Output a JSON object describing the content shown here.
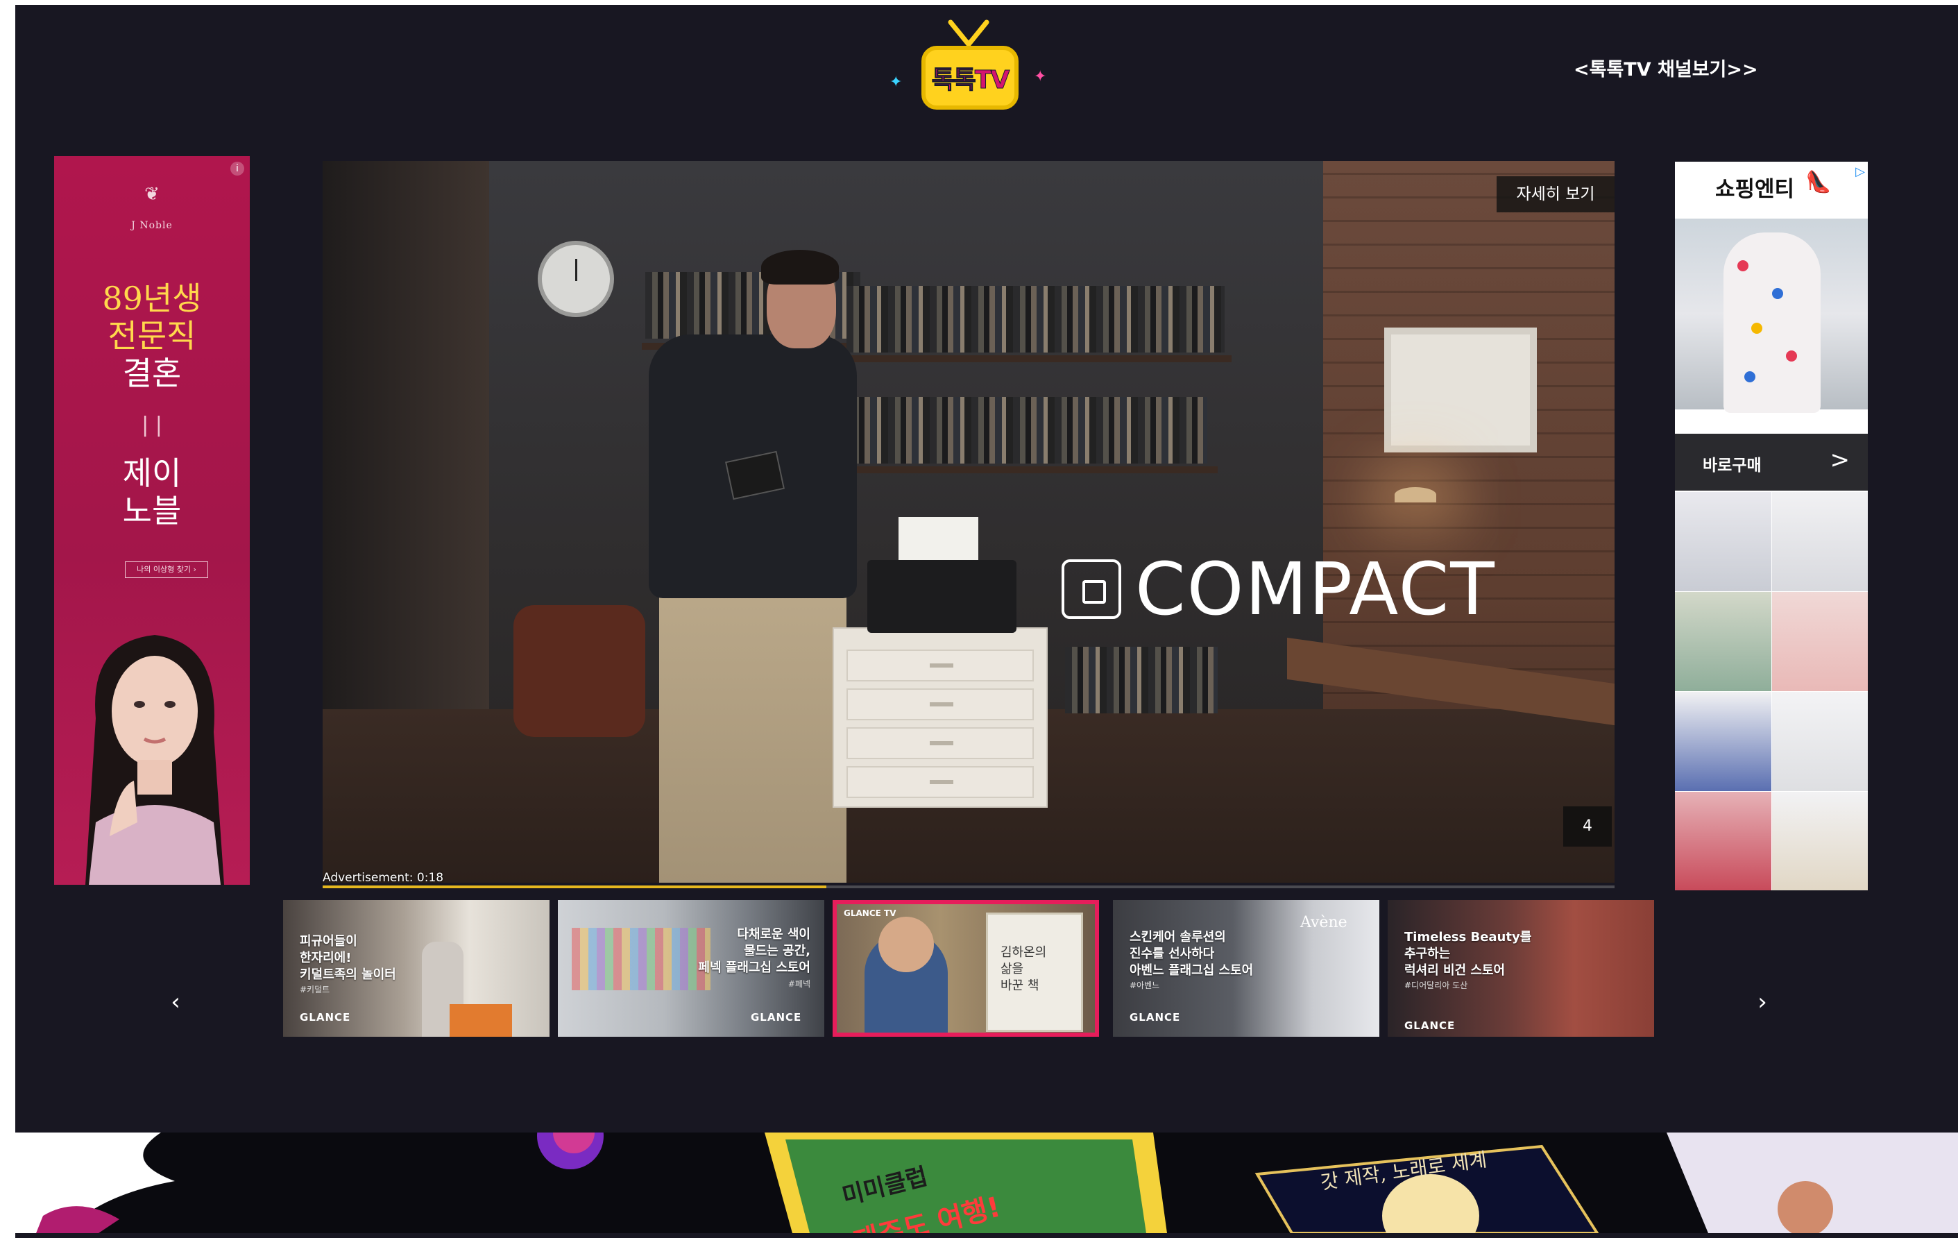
{
  "header": {
    "logo_text": "톡톡TV",
    "channel_link": "<톡톡TV 채널보기>>"
  },
  "left_ad": {
    "brand": "J Noble",
    "headline_1": "89년생",
    "headline_2": "전문직",
    "headline_3": "결혼",
    "divider": "| |",
    "sub_1": "제이",
    "sub_2": "노블",
    "cta": "나의 이상형 찾기  ›",
    "info": "i"
  },
  "video": {
    "overlay_word": "COMPACT",
    "more_button": "자세히 보기",
    "skip_count": "4",
    "ad_label": "Advertisement: 0:18",
    "progress_fraction": 0.39
  },
  "right_ad": {
    "brand": "쇼핑엔티",
    "buy_label": "바로구매",
    "buy_arrow": ">"
  },
  "carousel": {
    "prev": "‹",
    "next": "›",
    "items": [
      {
        "title_1": "피규어들이",
        "title_2": "한자리에!",
        "title_3": "키덜트족의 놀이터",
        "tag": "#키덜트",
        "brand": "GLANCE"
      },
      {
        "title_1": "다채로운 색이",
        "title_2": "물드는 공간,",
        "title_3": "페넥 플래그십 스토어",
        "tag": "#페넥",
        "brand": "GLANCE"
      },
      {
        "title_1": "김하온의",
        "title_2": "삶을",
        "title_3": "바꾼 책",
        "tag": "GLANCE TV",
        "brand": ""
      },
      {
        "title_1": "스킨케어 솔루션의",
        "title_2": "진수를 선사하다",
        "title_3": "아벤느 플래그십 스토어",
        "tag": "#아벤느",
        "brand": "GLANCE",
        "sign": "Avène"
      },
      {
        "title_1": "Timeless Beauty를",
        "title_2": "추구하는",
        "title_3": "럭셔리 비건 스토어",
        "tag": "#디어달리아 도산",
        "brand": "GLANCE"
      }
    ]
  },
  "bottom_banner": {
    "sign_text": "미미클럽",
    "sign_text_2": "제주도 여행!",
    "script_text": "갓 제작, 노래로 세계"
  },
  "colors": {
    "page_bg": "#181722",
    "accent_active": "#e61d5b",
    "progress": "#e6b81f",
    "left_ad_bg": "#a3164a"
  }
}
